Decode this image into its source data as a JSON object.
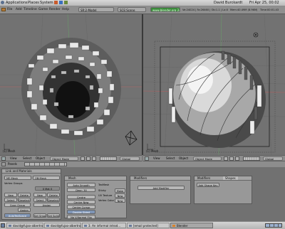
{
  "gnome_panel": {
    "menus": [
      "Applications",
      "Places",
      "System"
    ],
    "user": "David Burckardt",
    "clock": "Fri Apr 25, 00:02"
  },
  "blender_header": {
    "menus": [
      "File",
      "Add",
      "Timeline",
      "Game",
      "Render",
      "Help"
    ],
    "screen_box": "SR:2-Model",
    "scene_box": "SCE:Scene",
    "url": "www.blender.org 246",
    "stats": "Ve:24024 | Fa:26460 | Ob:1-1 | La:0",
    "mem": "Mem:40.49M (8.96M)",
    "time": "Time:00:01.43"
  },
  "viewports": {
    "left_label": "(1) Mesh",
    "right_label": "(1) Mesh"
  },
  "view_header": {
    "menus": [
      "View",
      "Select",
      "Object"
    ],
    "mode": "Object Mode",
    "layers": "Global"
  },
  "buttons_header": {
    "label": "Panels"
  },
  "panel_link": {
    "title": "Link and Materials",
    "me_field": "ME:Mesh",
    "ob_field": "OB:Mesh",
    "vertex_groups": "Vertex Groups",
    "material_count": "0 Mat 0",
    "buttons": [
      "New",
      "Delete",
      "Select",
      "Deselect",
      "Copy Group",
      "Assign",
      "New",
      "Delete",
      "Select",
      "Deselect",
      "Assign",
      "AutoTexSpace",
      "Set Smooth",
      "Set Solid"
    ]
  },
  "panel_mesh": {
    "title": "Mesh",
    "buttons": [
      "Auto Smooth",
      "Degr: 30",
      "Centre",
      "Centre New",
      "Centre Cursor",
      "Double Sided",
      "No V.Normal Flip"
    ],
    "labels": [
      "TexMesh",
      "Sticky",
      "UV Texture",
      "Vertex Color"
    ],
    "small_buttons": [
      "Make",
      "New",
      "New"
    ]
  },
  "panel_modifiers": {
    "title": "Modifiers",
    "add_button": "Add Modifier"
  },
  "panel_shapes": {
    "tabs": [
      "Modifiers",
      "Shapes"
    ],
    "add_button": "Add Shape Key"
  },
  "taskbar": {
    "tasks": [
      {
        "label": "david@fujoo-albertro",
        "active": false
      },
      {
        "label": "david@fujoo-albertro",
        "active": false
      },
      {
        "label": "3. An informal introd...",
        "active": false
      },
      {
        "label": "[email protected]",
        "active": false
      },
      {
        "label": "Blender",
        "active": true
      }
    ]
  },
  "colors": {
    "viewport_bg": "#727272",
    "url_green": "#3b8a3b",
    "red_button": "#c65a5a",
    "blue_button": "#7f95b6"
  }
}
